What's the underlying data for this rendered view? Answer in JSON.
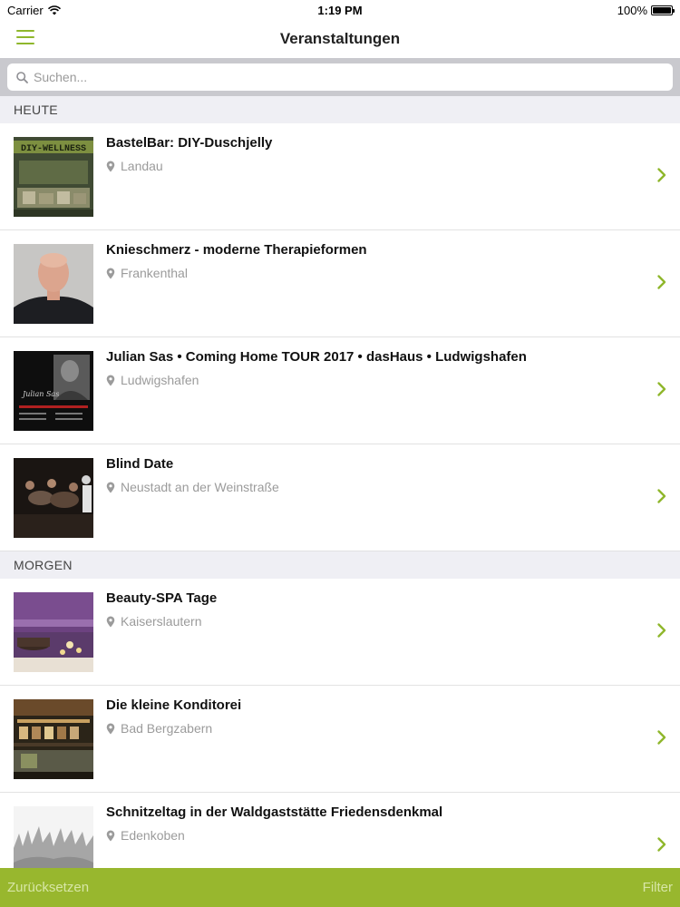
{
  "status_bar": {
    "carrier": "Carrier",
    "time": "1:19 PM",
    "battery": "100%"
  },
  "nav": {
    "title": "Veranstaltungen",
    "menu_icon": "hamburger-menu-icon"
  },
  "search": {
    "placeholder": "Suchen..."
  },
  "sections": [
    {
      "title": "HEUTE",
      "items": [
        {
          "title": "BastelBar: DIY-Duschjelly",
          "location": "Landau",
          "thumb_text": "DIY-WELLNESS"
        },
        {
          "title": "Knieschmerz - moderne Therapieformen",
          "location": "Frankenthal"
        },
        {
          "title": "Julian Sas • Coming Home TOUR 2017 • dasHaus • Ludwigshafen",
          "location": "Ludwigshafen",
          "thumb_text": "Julian Sas"
        },
        {
          "title": "Blind Date",
          "location": "Neustadt an der Weinstraße"
        }
      ]
    },
    {
      "title": "MORGEN",
      "items": [
        {
          "title": "Beauty-SPA Tage",
          "location": "Kaiserslautern"
        },
        {
          "title": "Die kleine Konditorei",
          "location": "Bad Bergzabern"
        },
        {
          "title": "Schnitzeltag in der Waldgaststätte Friedensdenkmal",
          "location": "Edenkoben"
        }
      ]
    }
  ],
  "bottom_bar": {
    "reset": "Zurücksetzen",
    "filter": "Filter"
  },
  "colors": {
    "accent": "#8fb72c",
    "bottom_bar": "#98b72e",
    "section_bg": "#efeff4",
    "search_bg": "#c9c9ce"
  }
}
